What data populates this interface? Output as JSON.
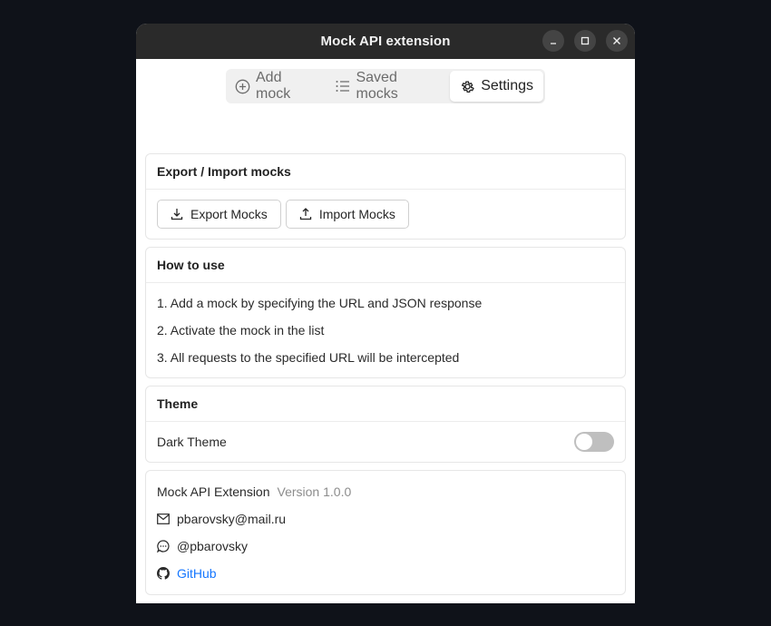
{
  "window": {
    "title": "Mock API extension"
  },
  "tabs": [
    {
      "label": "Add mock",
      "icon": "plus-circle-icon",
      "active": false
    },
    {
      "label": "Saved mocks",
      "icon": "list-icon",
      "active": false
    },
    {
      "label": "Settings",
      "icon": "gear-icon",
      "active": true
    }
  ],
  "export_import": {
    "title": "Export / Import mocks",
    "export_label": "Export Mocks",
    "import_label": "Import Mocks"
  },
  "how_to": {
    "title": "How to use",
    "steps": [
      "1. Add a mock by specifying the URL and JSON response",
      "2. Activate the mock in the list",
      "3. All requests to the specified URL will be intercepted"
    ]
  },
  "theme": {
    "title": "Theme",
    "dark_theme_label": "Dark Theme",
    "dark_theme_enabled": false
  },
  "about": {
    "name": "Mock API Extension",
    "version": "Version 1.0.0",
    "email": "pbarovsky@mail.ru",
    "handle": "@pbarovsky",
    "github_label": "GitHub"
  },
  "colors": {
    "link": "#1677ff",
    "titlebar": "#2a2a2a",
    "desktop": "#0f1219"
  }
}
